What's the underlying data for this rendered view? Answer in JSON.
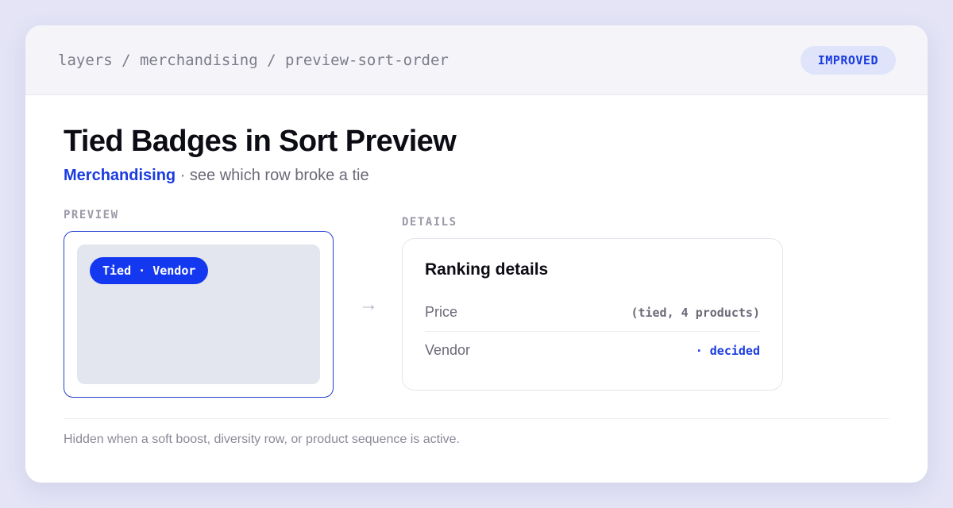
{
  "header": {
    "breadcrumb": "layers / merchandising / preview-sort-order",
    "status_badge": "IMPROVED"
  },
  "main": {
    "title": "Tied Badges in Sort Preview",
    "subtitle_accent": "Merchandising",
    "subtitle_rest": " · see which row broke a tie"
  },
  "preview": {
    "section_label": "PREVIEW",
    "chip_label": "Tied · Vendor"
  },
  "details": {
    "section_label": "DETAILS",
    "card_title": "Ranking details",
    "rows": [
      {
        "name": "Price",
        "value": "(tied, 4 products)"
      },
      {
        "name": "Vendor",
        "value": "· decided"
      }
    ]
  },
  "footer": {
    "note": "Hidden when a soft boost, diversity row, or product sequence is active."
  },
  "colors": {
    "accent": "#1a3be0",
    "chip_background": "#1438ef",
    "badge_background": "#dfe4fb",
    "page_background": "#e4e4f6"
  },
  "icons": {
    "flow_arrow": "right-arrow-icon"
  }
}
